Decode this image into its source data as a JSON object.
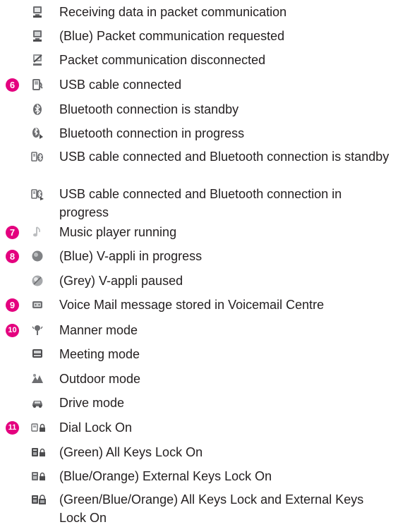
{
  "items": [
    {
      "number": "",
      "icon": "packet-receiving-icon",
      "text": "Receiving data in packet communication"
    },
    {
      "number": "",
      "icon": "packet-requested-icon",
      "text": "(Blue) Packet communication requested"
    },
    {
      "number": "",
      "icon": "packet-disconnected-icon",
      "text": "Packet communication disconnected"
    },
    {
      "number": "6",
      "icon": "usb-connected-icon",
      "text": "USB cable connected"
    },
    {
      "number": "",
      "icon": "bluetooth-standby-icon",
      "text": "Bluetooth connection is standby"
    },
    {
      "number": "",
      "icon": "bluetooth-progress-icon",
      "text": "Bluetooth connection in progress"
    },
    {
      "number": "",
      "icon": "usb-bluetooth-standby-icon",
      "text": "USB cable connected and Bluetooth connection is standby"
    },
    {
      "number": "",
      "icon": "usb-bluetooth-progress-icon",
      "text": "USB cable connected and Bluetooth connection in progress"
    },
    {
      "number": "7",
      "icon": "music-note-icon",
      "text": "Music player running"
    },
    {
      "number": "8",
      "icon": "v-appli-running-icon",
      "text": "(Blue) V-appli in progress"
    },
    {
      "number": "",
      "icon": "v-appli-paused-icon",
      "text": "(Grey) V-appli paused"
    },
    {
      "number": "9",
      "icon": "voicemail-icon",
      "text": "Voice Mail message stored in Voicemail Centre"
    },
    {
      "number": "10",
      "icon": "manner-mode-icon",
      "text": "Manner mode"
    },
    {
      "number": "",
      "icon": "meeting-mode-icon",
      "text": "Meeting mode"
    },
    {
      "number": "",
      "icon": "outdoor-mode-icon",
      "text": "Outdoor mode"
    },
    {
      "number": "",
      "icon": "drive-mode-icon",
      "text": "Drive mode"
    },
    {
      "number": "11",
      "icon": "dial-lock-icon",
      "text": "Dial Lock On"
    },
    {
      "number": "",
      "icon": "all-keys-lock-icon",
      "text": "(Green) All Keys Lock On"
    },
    {
      "number": "",
      "icon": "external-keys-lock-icon",
      "text": "(Blue/Orange) External Keys Lock On"
    },
    {
      "number": "",
      "icon": "all-and-external-keys-lock-icon",
      "text": "(Green/Blue/Orange) All Keys Lock and External Keys Lock On"
    }
  ]
}
